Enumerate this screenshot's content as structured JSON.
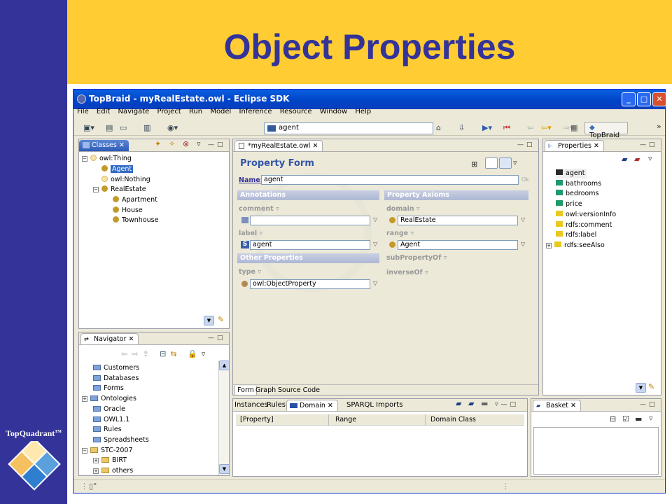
{
  "slide": {
    "title": "Object Properties",
    "brand": "TopQuadrant",
    "brand_tm": "TM"
  },
  "colors": {
    "slide_left": "#333399",
    "slide_banner": "#FFCC33",
    "title_text": "#333399",
    "window_title": "#0A50D8",
    "selection": "#316AC5"
  },
  "window": {
    "title": "TopBraid - myRealEstate.owl - Eclipse SDK"
  },
  "menu": [
    "File",
    "Edit",
    "Navigate",
    "Project",
    "Run",
    "Model",
    "Inference",
    "Resource",
    "Window",
    "Help"
  ],
  "toolbar": {
    "search_value": "agent",
    "topbraid_label": "TopBraid"
  },
  "classes": {
    "tab": "Classes",
    "tree": [
      {
        "label": "owl:Thing"
      },
      {
        "label": "Agent"
      },
      {
        "label": "owl:Nothing"
      },
      {
        "label": "RealEstate"
      },
      {
        "label": "Apartment"
      },
      {
        "label": "House"
      },
      {
        "label": "Townhouse"
      }
    ]
  },
  "navigator": {
    "tab": "Navigator",
    "items": [
      "Customers",
      "Databases",
      "Forms",
      "Ontologies",
      "Oracle",
      "OWL1.1",
      "Rules",
      "Spreadsheets",
      "STC-2007",
      "BIRT",
      "others"
    ]
  },
  "editor": {
    "tab": "*myRealEstate.owl",
    "form_title": "Property Form",
    "name_label": "Name:",
    "name_value": "agent",
    "ok": "Ok",
    "annotations": "Annotations",
    "property_axioms": "Property Axioms",
    "comment": "comment",
    "comment_value": "",
    "label": "label",
    "label_value": "agent",
    "label_badge": "S",
    "other_properties": "Other Properties",
    "type": "type",
    "type_value": "owl:ObjectProperty",
    "domain": "domain",
    "domain_value": "RealEstate",
    "range": "range",
    "range_value": "Agent",
    "subPropertyOf": "subPropertyOf",
    "inverseOf": "inverseOf",
    "bottom_tabs": [
      "Form",
      "Graph",
      "Source Code"
    ]
  },
  "properties": {
    "tab": "Properties",
    "items": [
      {
        "label": "agent",
        "color": "#2a2a2a"
      },
      {
        "label": "bathrooms",
        "color": "#1e9a6a"
      },
      {
        "label": "bedrooms",
        "color": "#1e9a6a"
      },
      {
        "label": "price",
        "color": "#1e9a6a"
      },
      {
        "label": "owl:versionInfo",
        "color": "#e8c920"
      },
      {
        "label": "rdfs:comment",
        "color": "#e8c920"
      },
      {
        "label": "rdfs:label",
        "color": "#e8c920"
      },
      {
        "label": "rdfs:seeAlso",
        "color": "#e8c920"
      }
    ]
  },
  "domain_view": {
    "tabs": [
      "Instances",
      "Rules",
      "Domain",
      "SPARQL",
      "Imports"
    ],
    "columns": [
      "[Property]",
      "Range",
      "Domain Class"
    ]
  },
  "basket": {
    "tab": "Basket"
  }
}
